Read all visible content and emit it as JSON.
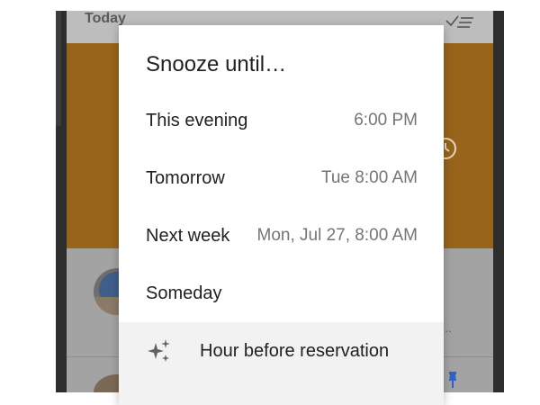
{
  "background": {
    "header_label": "Today",
    "icons": {
      "done_all": "done-all-icon",
      "clock": "clock-icon",
      "pin": "pin-icon"
    },
    "banner_color": "#98641b",
    "list_ellipsis": "..."
  },
  "dialog": {
    "title": "Snooze until…",
    "options": [
      {
        "label": "This evening",
        "time": "6:00 PM"
      },
      {
        "label": "Tomorrow",
        "time": "Tue 8:00 AM"
      },
      {
        "label": "Next week",
        "time": "Mon, Jul 27, 8:00 AM"
      },
      {
        "label": "Someday",
        "time": ""
      },
      {
        "label": "Hour before reservation",
        "icon": "sparkle-icon"
      }
    ]
  }
}
